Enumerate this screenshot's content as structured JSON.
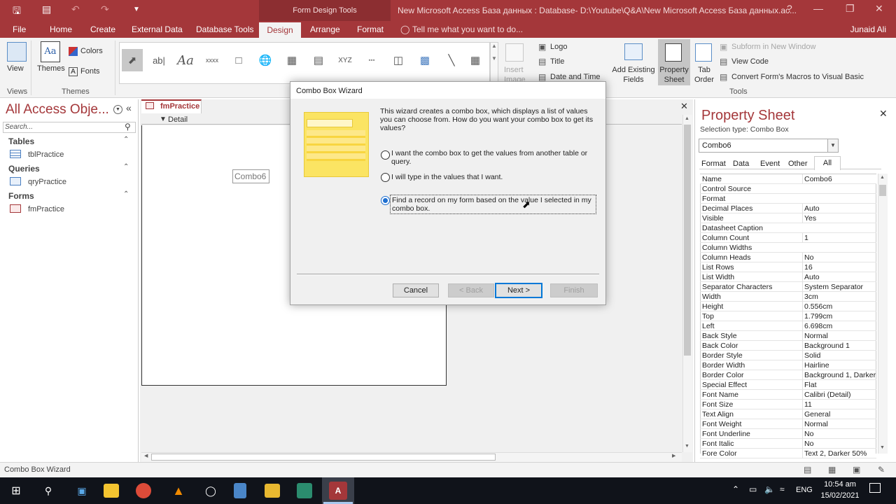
{
  "titlebar": {
    "tools_label": "Form Design Tools",
    "title": "New Microsoft Access База данных : Database- D:\\Youtube\\Q&A\\New Microsoft Access База данных.ac...",
    "help": "?"
  },
  "tabs": [
    "File",
    "Home",
    "Create",
    "External Data",
    "Database Tools",
    "Design",
    "Arrange",
    "Format"
  ],
  "tell_me": "Tell me what you want to do...",
  "user": "Junaid Ali",
  "ribbon": {
    "view": "View",
    "themes": "Themes",
    "colors": "Colors",
    "fonts": "Fonts",
    "group_views": "Views",
    "group_themes": "Themes",
    "insert_image": "Insert Image",
    "logo": "Logo",
    "title": "Title",
    "date_time": "Date and Time",
    "add_fields": "Add Existing Fields",
    "property_sheet": "Property Sheet",
    "tab_order": "Tab Order",
    "subform": "Subform in New Window",
    "view_code": "View Code",
    "convert": "Convert Form's Macros to Visual Basic",
    "group_tools": "Tools"
  },
  "nav": {
    "title": "All Access Obje...",
    "search_placeholder": "Search...",
    "sections": [
      {
        "name": "Tables",
        "item": "tblPractice"
      },
      {
        "name": "Queries",
        "item": "qryPractice"
      },
      {
        "name": "Forms",
        "item": "fmPractice"
      }
    ]
  },
  "doc": {
    "tab": "fmPractice",
    "section": "Detail",
    "combo": "Combo6"
  },
  "dialog": {
    "title": "Combo Box Wizard",
    "intro": "This wizard creates a combo box, which displays a list of values you can choose from.  How do you want your combo box to get its values?",
    "option1": "I want the combo box to get the values from another table or query.",
    "option2": "I will type in the values that I want.",
    "option3": "Find a record on my form based on the value I selected in my combo box.",
    "selected_option": 3,
    "cancel": "Cancel",
    "back": "< Back",
    "next": "Next >",
    "finish": "Finish"
  },
  "property_sheet": {
    "title": "Property Sheet",
    "selection_type": "Selection type:  Combo Box",
    "selected": "Combo6",
    "tabs": [
      "Format",
      "Data",
      "Event",
      "Other",
      "All"
    ],
    "rows": [
      [
        "Name",
        "Combo6"
      ],
      [
        "Control Source",
        ""
      ],
      [
        "Format",
        ""
      ],
      [
        "Decimal Places",
        "Auto"
      ],
      [
        "Visible",
        "Yes"
      ],
      [
        "Datasheet Caption",
        ""
      ],
      [
        "Column Count",
        "1"
      ],
      [
        "Column Widths",
        ""
      ],
      [
        "Column Heads",
        "No"
      ],
      [
        "List Rows",
        "16"
      ],
      [
        "List Width",
        "Auto"
      ],
      [
        "Separator Characters",
        "System Separator"
      ],
      [
        "Width",
        "3cm"
      ],
      [
        "Height",
        "0.556cm"
      ],
      [
        "Top",
        "1.799cm"
      ],
      [
        "Left",
        "6.698cm"
      ],
      [
        "Back Style",
        "Normal"
      ],
      [
        "Back Color",
        "Background 1"
      ],
      [
        "Border Style",
        "Solid"
      ],
      [
        "Border Width",
        "Hairline"
      ],
      [
        "Border Color",
        "Background 1, Darker"
      ],
      [
        "Special Effect",
        "Flat"
      ],
      [
        "Font Name",
        "Calibri (Detail)"
      ],
      [
        "Font Size",
        "11"
      ],
      [
        "Text Align",
        "General"
      ],
      [
        "Font Weight",
        "Normal"
      ],
      [
        "Font Underline",
        "No"
      ],
      [
        "Font Italic",
        "No"
      ],
      [
        "Fore Color",
        "Text 2, Darker 50%"
      ]
    ]
  },
  "status": "Combo Box Wizard",
  "taskbar": {
    "lang": "ENG",
    "time": "10:54 am",
    "date": "15/02/2021"
  },
  "colors": {
    "accent": "#a4373a",
    "dialog_bg": "#f0f0f0",
    "taskbar": "#10131a"
  }
}
